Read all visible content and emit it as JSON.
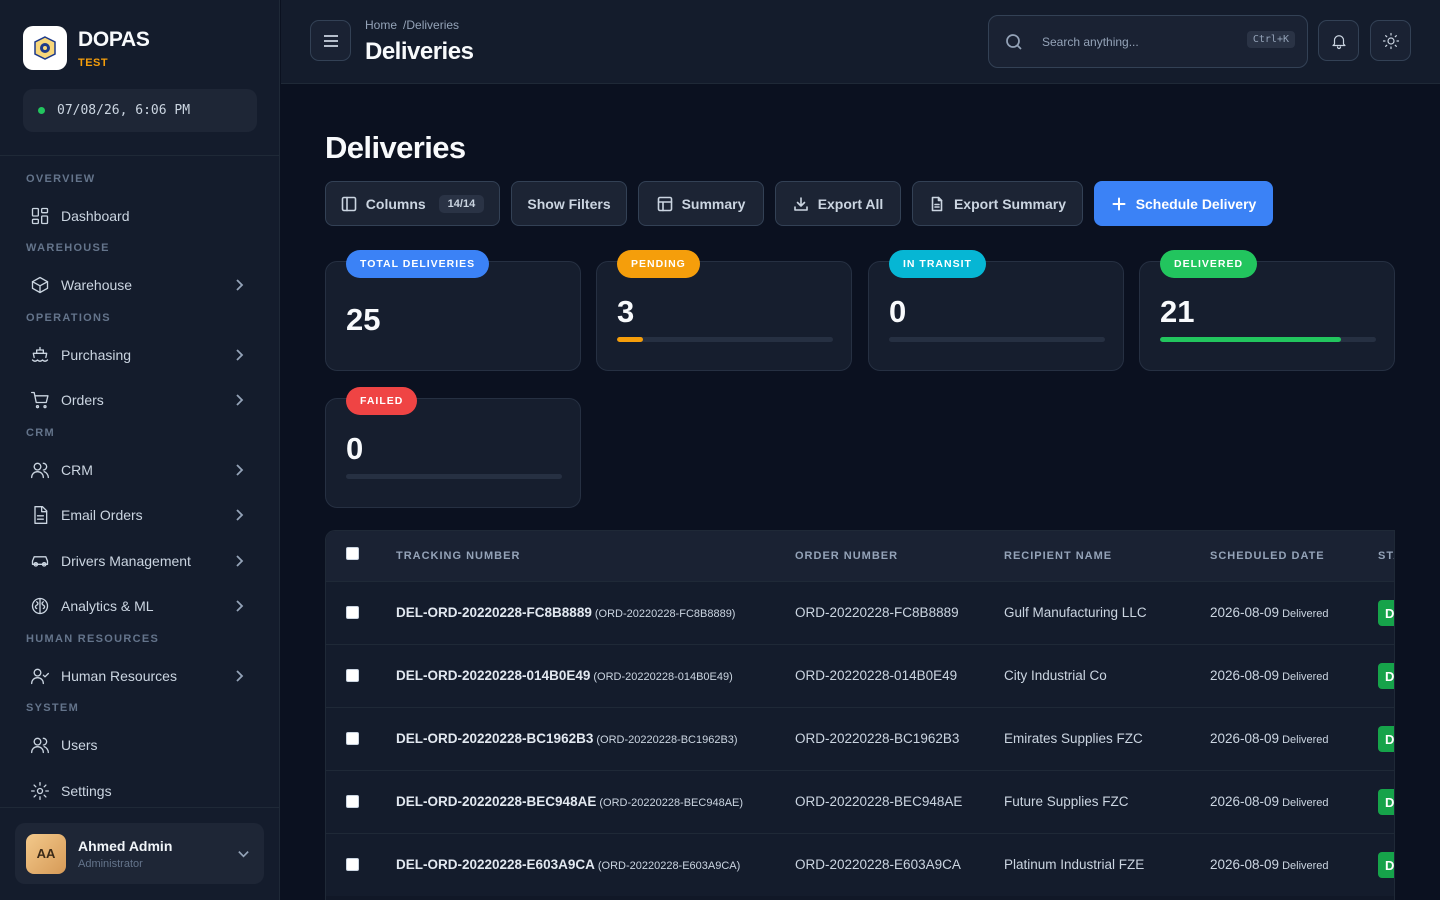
{
  "brand": {
    "name": "DOPAS",
    "env": "TEST"
  },
  "clock": "07/08/26, 6:06 PM",
  "sidebar": {
    "sections": {
      "overview": "OVERVIEW",
      "warehouse": "WAREHOUSE",
      "operations": "OPERATIONS",
      "crm": "CRM",
      "hr": "HUMAN RESOURCES",
      "system": "SYSTEM"
    },
    "items": {
      "dashboard": "Dashboard",
      "warehouse": "Warehouse",
      "purchasing": "Purchasing",
      "orders": "Orders",
      "crm": "CRM",
      "email_orders": "Email Orders",
      "drivers": "Drivers Management",
      "analytics": "Analytics & ML",
      "hr": "Human Resources",
      "users": "Users",
      "settings": "Settings"
    }
  },
  "user": {
    "initials": "AA",
    "name": "Ahmed Admin",
    "role": "Administrator"
  },
  "header": {
    "breadcrumb_home": "Home",
    "breadcrumb_current": "/Deliveries",
    "title": "Deliveries",
    "search_placeholder": "Search anything...",
    "search_shortcut": "Ctrl+K"
  },
  "page": {
    "title": "Deliveries"
  },
  "toolbar": {
    "columns_label": "Columns",
    "columns_count": "14/14",
    "show_filters": "Show Filters",
    "summary": "Summary",
    "export_all": "Export All",
    "export_summary": "Export Summary",
    "schedule_delivery": "Schedule Delivery"
  },
  "stats": {
    "total": {
      "label": "TOTAL DELIVERIES",
      "value": "25",
      "color": "#3b82f6"
    },
    "pending": {
      "label": "PENDING",
      "value": "3",
      "color": "#f59e0b",
      "progress": 0.12
    },
    "in_transit": {
      "label": "IN TRANSIT",
      "value": "0",
      "color": "#06b6d4",
      "progress": 0
    },
    "delivered": {
      "label": "DELIVERED",
      "value": "21",
      "color": "#22c55e",
      "progress": 0.84
    },
    "failed": {
      "label": "FAILED",
      "value": "0",
      "color": "#ef4444",
      "progress": 0
    }
  },
  "table": {
    "headers": {
      "tracking": "TRACKING NUMBER",
      "order": "ORDER NUMBER",
      "recipient": "RECIPIENT NAME",
      "scheduled": "SCHEDULED DATE",
      "status": "STA"
    },
    "rows": [
      {
        "tracking": "DEL-ORD-20220228-FC8B8889",
        "tracking_sub": "(ORD-20220228-FC8B8889)",
        "order": "ORD-20220228-FC8B8889",
        "recipient": "Gulf Manufacturing LLC",
        "date": "2026-08-09",
        "date_status": "Delivered",
        "status": "D"
      },
      {
        "tracking": "DEL-ORD-20220228-014B0E49",
        "tracking_sub": "(ORD-20220228-014B0E49)",
        "order": "ORD-20220228-014B0E49",
        "recipient": "City Industrial Co",
        "date": "2026-08-09",
        "date_status": "Delivered",
        "status": "D"
      },
      {
        "tracking": "DEL-ORD-20220228-BC1962B3",
        "tracking_sub": "(ORD-20220228-BC1962B3)",
        "order": "ORD-20220228-BC1962B3",
        "recipient": "Emirates Supplies FZC",
        "date": "2026-08-09",
        "date_status": "Delivered",
        "status": "D"
      },
      {
        "tracking": "DEL-ORD-20220228-BEC948AE",
        "tracking_sub": "(ORD-20220228-BEC948AE)",
        "order": "ORD-20220228-BEC948AE",
        "recipient": "Future Supplies FZC",
        "date": "2026-08-09",
        "date_status": "Delivered",
        "status": "D"
      },
      {
        "tracking": "DEL-ORD-20220228-E603A9CA",
        "tracking_sub": "(ORD-20220228-E603A9CA)",
        "order": "ORD-20220228-E603A9CA",
        "recipient": "Platinum Industrial FZE",
        "date": "2026-08-09",
        "date_status": "Delivered",
        "status": "D"
      }
    ]
  }
}
